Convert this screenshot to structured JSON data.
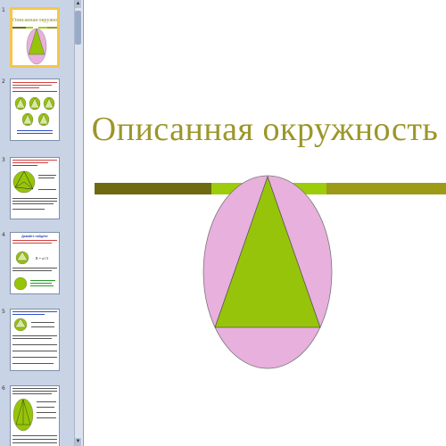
{
  "slides": [
    {
      "number": "1",
      "title": "Описанная окружность",
      "selected": true
    },
    {
      "number": "2",
      "heading": "Определение",
      "selected": false
    },
    {
      "number": "3",
      "heading": "Теорема",
      "selected": false
    },
    {
      "number": "4",
      "heading": "Давайте найдём!",
      "formula": "R = a/√3",
      "selected": false
    },
    {
      "number": "5",
      "heading": "",
      "selected": false
    },
    {
      "number": "6",
      "heading": "",
      "selected": false
    }
  ],
  "main_slide": {
    "title": "Описанная окружность"
  },
  "colors": {
    "title": "#9c962a",
    "band_dark": "#6e6a12",
    "band_light": "#9dcc0a",
    "band_olive": "#9c9a16",
    "ellipse_fill": "#e8b0dc",
    "triangle_fill": "#96c40a",
    "selection_border": "#f4c64e"
  },
  "icons": {
    "scroll_up": "triangle-up-icon",
    "scroll_down": "triangle-down-icon"
  }
}
